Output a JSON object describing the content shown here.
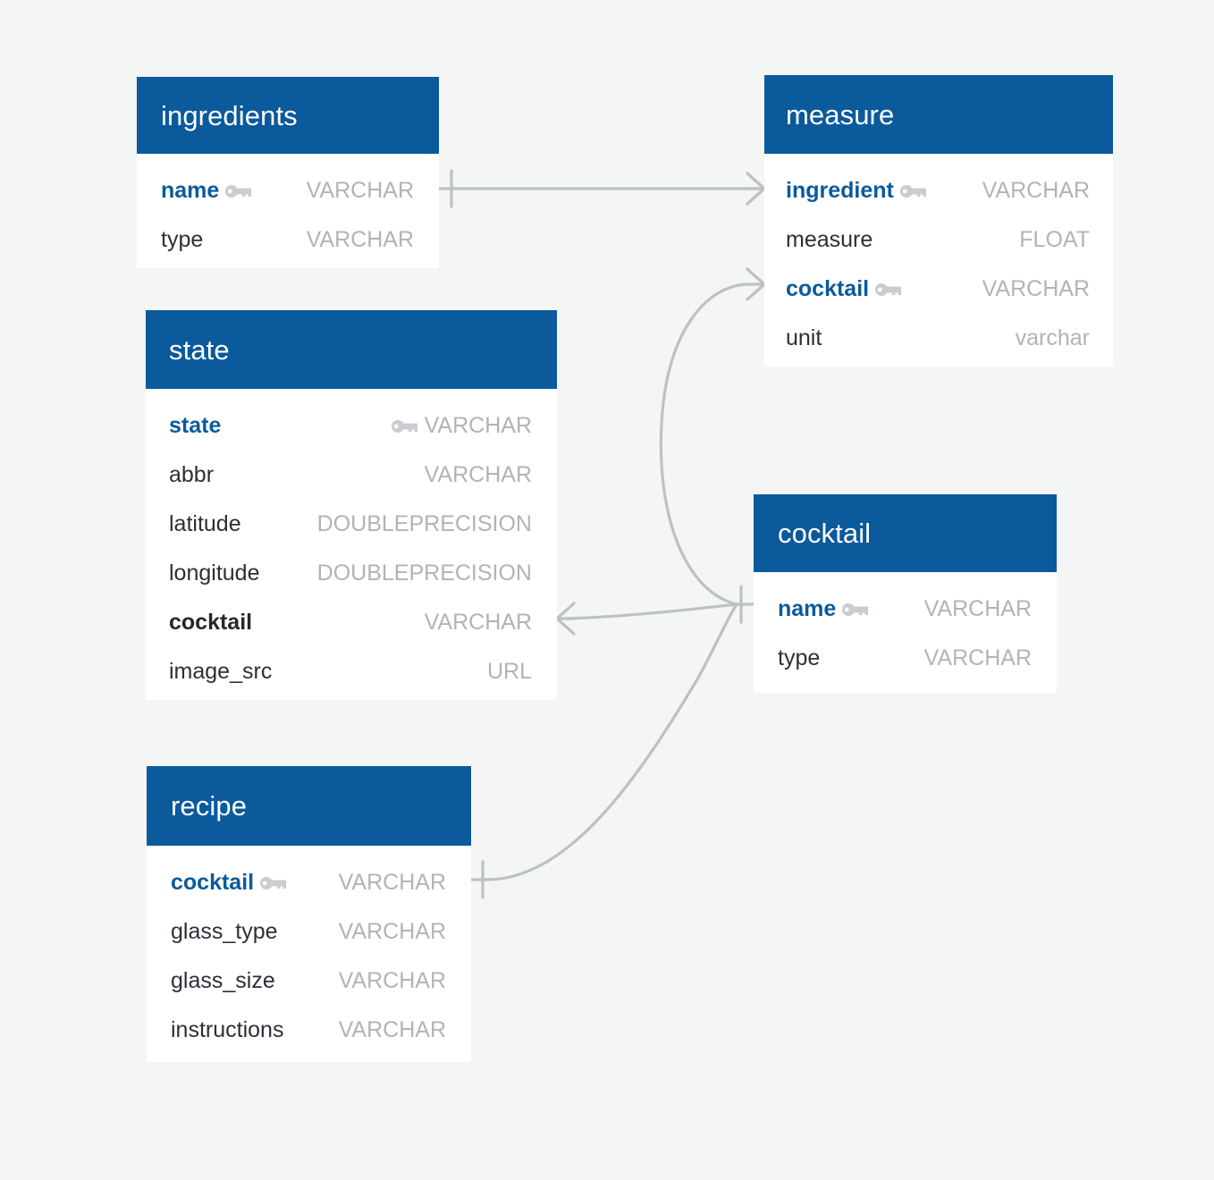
{
  "diagram": {
    "kind": "entity-relationship-diagram",
    "background_color": "#f4f5f5",
    "header_color": "#0a5a9c",
    "pk_text_color": "#0a5a9c",
    "type_text_color": "#b0b4b8",
    "relation_line_color": "#bdc1c2"
  },
  "entities": {
    "ingredients": {
      "title": "ingredients",
      "fields": [
        {
          "name": "name",
          "type": "VARCHAR",
          "key": "key-icon",
          "style": "pk"
        },
        {
          "name": "type",
          "type": "VARCHAR",
          "key": "",
          "style": "plain"
        }
      ]
    },
    "measure": {
      "title": "measure",
      "fields": [
        {
          "name": "ingredient",
          "type": "VARCHAR",
          "key": "key-icon",
          "style": "pk"
        },
        {
          "name": "measure",
          "type": "FLOAT",
          "key": "",
          "style": "plain"
        },
        {
          "name": "cocktail",
          "type": "VARCHAR",
          "key": "key-icon",
          "style": "pk"
        },
        {
          "name": "unit",
          "type": "varchar",
          "key": "",
          "style": "plain"
        }
      ]
    },
    "state": {
      "title": "state",
      "fields": [
        {
          "name": "state",
          "type": "VARCHAR",
          "key": "key-icon",
          "style": "pk"
        },
        {
          "name": "abbr",
          "type": "VARCHAR",
          "key": "",
          "style": "plain"
        },
        {
          "name": "latitude",
          "type": "DOUBLEPRECISION",
          "key": "",
          "style": "plain"
        },
        {
          "name": "longitude",
          "type": "DOUBLEPRECISION",
          "key": "",
          "style": "plain"
        },
        {
          "name": "cocktail",
          "type": "VARCHAR",
          "key": "",
          "style": "fk"
        },
        {
          "name": "image_src",
          "type": "URL",
          "key": "",
          "style": "plain"
        }
      ]
    },
    "cocktail": {
      "title": "cocktail",
      "fields": [
        {
          "name": "name",
          "type": "VARCHAR",
          "key": "key-icon",
          "style": "pk"
        },
        {
          "name": "type",
          "type": "VARCHAR",
          "key": "",
          "style": "plain"
        }
      ]
    },
    "recipe": {
      "title": "recipe",
      "fields": [
        {
          "name": "cocktail",
          "type": "VARCHAR",
          "key": "key-icon",
          "style": "pk"
        },
        {
          "name": "glass_type",
          "type": "VARCHAR",
          "key": "",
          "style": "plain"
        },
        {
          "name": "glass_size",
          "type": "VARCHAR",
          "key": "",
          "style": "plain"
        },
        {
          "name": "instructions",
          "type": "VARCHAR",
          "key": "",
          "style": "plain"
        }
      ]
    }
  },
  "relationships": [
    {
      "from": "ingredients.name",
      "to": "measure.ingredient",
      "from_cardinality": "one",
      "to_cardinality": "many"
    },
    {
      "from": "cocktail.name",
      "to": "measure.cocktail",
      "from_cardinality": "one",
      "to_cardinality": "many"
    },
    {
      "from": "state.cocktail",
      "to": "cocktail.name",
      "from_cardinality": "many",
      "to_cardinality": "one"
    },
    {
      "from": "recipe.cocktail",
      "to": "cocktail.name",
      "from_cardinality": "one",
      "to_cardinality": "one"
    }
  ]
}
